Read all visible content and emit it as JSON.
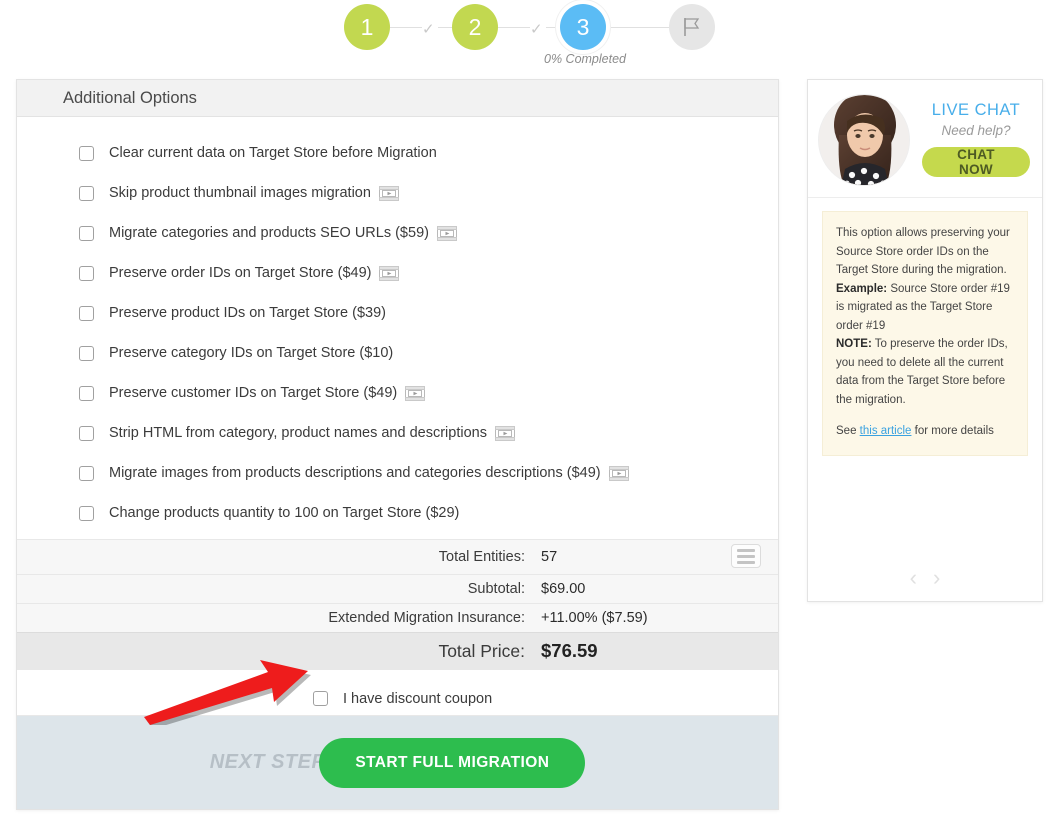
{
  "stepper": {
    "steps": [
      {
        "label": "1",
        "state": "done"
      },
      {
        "label": "2",
        "state": "done"
      },
      {
        "label": "3",
        "state": "active"
      }
    ],
    "check_glyph": "✓",
    "flag_icon": "flag-icon",
    "progress_text": "0% Completed",
    "active_color": "#5bbcf5",
    "done_color": "#c2d850"
  },
  "panel": {
    "header_title": "Additional Options",
    "options": [
      {
        "label": "Clear current data on Target Store before Migration",
        "has_video": false,
        "checked": false
      },
      {
        "label": "Skip product thumbnail images migration",
        "has_video": true,
        "checked": false
      },
      {
        "label": "Migrate categories and products SEO URLs ($59)",
        "has_video": true,
        "checked": false
      },
      {
        "label": "Preserve order IDs on Target Store ($49)",
        "has_video": true,
        "checked": false
      },
      {
        "label": "Preserve product IDs on Target Store ($39)",
        "has_video": false,
        "checked": false
      },
      {
        "label": "Preserve category IDs on Target Store ($10)",
        "has_video": false,
        "checked": false
      },
      {
        "label": "Preserve customer IDs on Target Store ($49)",
        "has_video": true,
        "checked": false
      },
      {
        "label": "Strip HTML from category, product names and descriptions",
        "has_video": true,
        "checked": false
      },
      {
        "label": "Migrate images from products descriptions and categories descriptions ($49)",
        "has_video": true,
        "checked": false
      },
      {
        "label": "Change products quantity to 100 on Target Store ($29)",
        "has_video": false,
        "checked": false
      }
    ],
    "summary": [
      {
        "label": "Total Entities:",
        "value": "57",
        "emphasis": false
      },
      {
        "label": "Subtotal:",
        "value": "$69.00",
        "emphasis": false
      },
      {
        "label": "Extended Migration Insurance:",
        "value": "+11.00% ($7.59)",
        "emphasis": false
      },
      {
        "label": "Total Price:",
        "value": "$76.59",
        "emphasis": true
      }
    ],
    "entities_icon": "list-lines-icon",
    "coupon": {
      "label": "I have discount coupon",
      "checked": false
    }
  },
  "footer": {
    "next_step_label": "NEXT STEP",
    "start_button_label": "START FULL MIGRATION",
    "start_button_color": "#2dbd4e",
    "bar_color": "#dde5ea"
  },
  "sidebar": {
    "avatar": "support-agent-avatar",
    "live_chat_title": "LIVE CHAT",
    "need_help_text": "Need help?",
    "chat_button_label": "CHAT NOW",
    "chat_button_color": "#c5d94d",
    "live_chat_color": "#48aeea",
    "tooltip": {
      "paragraph_1": "This option allows preserving your Source Store order IDs on the Target Store during the migration.",
      "example_label": "Example:",
      "example_text": " Source Store order #19 is migrated as the Target Store order #19",
      "note_label": "NOTE:",
      "note_text": " To preserve the order IDs, you need to delete all the current data from the Target Store before the migration.",
      "see_prefix": "See ",
      "link_text": "this article",
      "see_suffix": " for more details"
    },
    "carousel": {
      "prev": "‹",
      "next": "›"
    }
  },
  "annotation": {
    "arrow": "red-pointer-arrow",
    "color": "#ee1c1c"
  }
}
